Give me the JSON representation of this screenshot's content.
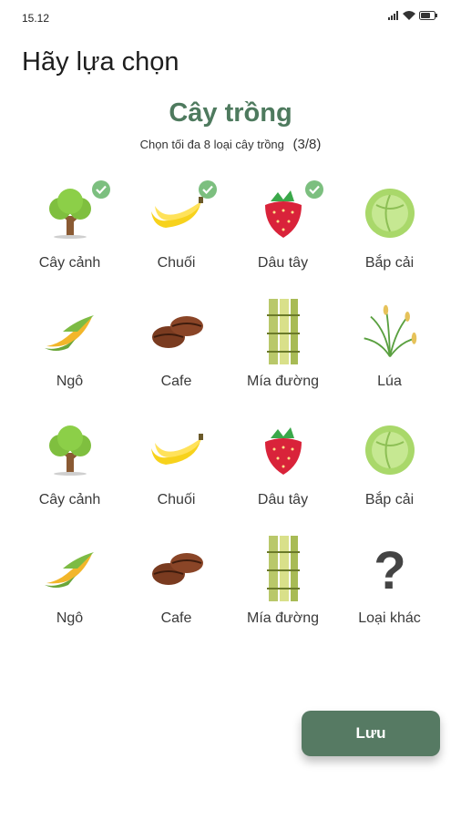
{
  "status": {
    "time": "15.12",
    "icons": [
      "signal-icon",
      "wifi-icon",
      "battery-icon"
    ]
  },
  "header": {
    "title": "Hãy lựa chọn"
  },
  "section": {
    "title": "Cây trồng",
    "subtitle": "Chọn tối đa 8 loại cây trồng",
    "count": "(3/8)"
  },
  "crops": [
    {
      "label": "Cây cảnh",
      "icon": "tree-icon",
      "selected": true
    },
    {
      "label": "Chuối",
      "icon": "banana-icon",
      "selected": true
    },
    {
      "label": "Dâu tây",
      "icon": "strawberry-icon",
      "selected": true
    },
    {
      "label": "Bắp cải",
      "icon": "cabbage-icon",
      "selected": false
    },
    {
      "label": "Ngô",
      "icon": "corn-icon",
      "selected": false
    },
    {
      "label": "Cafe",
      "icon": "coffee-bean-icon",
      "selected": false
    },
    {
      "label": "Mía đường",
      "icon": "sugarcane-icon",
      "selected": false
    },
    {
      "label": "Lúa",
      "icon": "rice-icon",
      "selected": false
    },
    {
      "label": "Cây cảnh",
      "icon": "tree-icon",
      "selected": false
    },
    {
      "label": "Chuối",
      "icon": "banana-icon",
      "selected": false
    },
    {
      "label": "Dâu tây",
      "icon": "strawberry-icon",
      "selected": false
    },
    {
      "label": "Bắp cải",
      "icon": "cabbage-icon",
      "selected": false
    },
    {
      "label": "Ngô",
      "icon": "corn-icon",
      "selected": false
    },
    {
      "label": "Cafe",
      "icon": "coffee-bean-icon",
      "selected": false
    },
    {
      "label": "Mía đường",
      "icon": "sugarcane-icon",
      "selected": false
    },
    {
      "label": "Loại khác",
      "icon": "question-mark-icon",
      "selected": false
    }
  ],
  "actions": {
    "save_label": "Lưu"
  },
  "colors": {
    "accent": "#4e7a5e",
    "button": "#567a63",
    "check": "#7cbf7f"
  }
}
